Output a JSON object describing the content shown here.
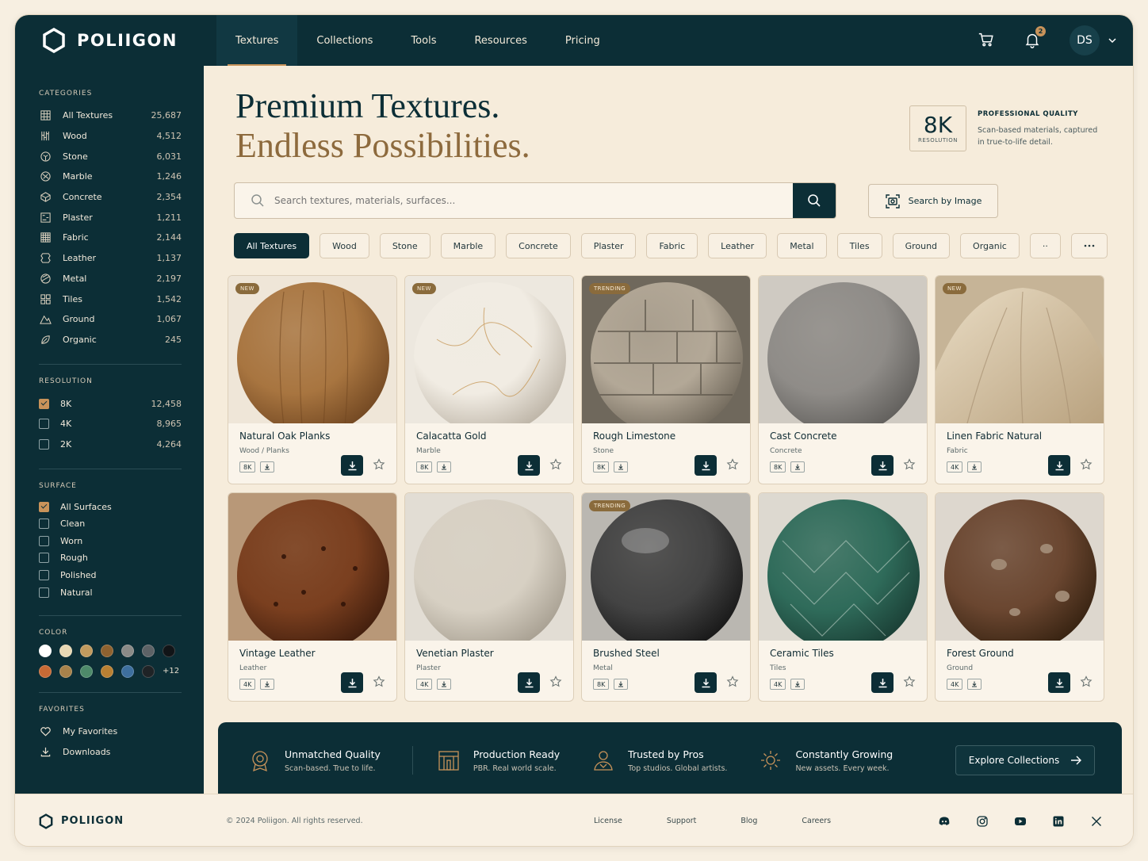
{
  "brand": {
    "name": "POLIIGON"
  },
  "nav": {
    "links": [
      "Textures",
      "Collections",
      "Tools",
      "Resources",
      "Pricing"
    ],
    "active": "Textures",
    "notifications_count": "2",
    "avatar_initials": "DS"
  },
  "sidebar": {
    "categories_title": "CATEGORIES",
    "categories": [
      {
        "label": "All Textures",
        "count": "25,687",
        "icon": "grid-icon"
      },
      {
        "label": "Wood",
        "count": "4,512",
        "icon": "wood-icon"
      },
      {
        "label": "Stone",
        "count": "6,031",
        "icon": "stone-icon"
      },
      {
        "label": "Marble",
        "count": "1,246",
        "icon": "marble-icon"
      },
      {
        "label": "Concrete",
        "count": "2,354",
        "icon": "cube-icon"
      },
      {
        "label": "Plaster",
        "count": "1,211",
        "icon": "plaster-icon"
      },
      {
        "label": "Fabric",
        "count": "2,144",
        "icon": "fabric-icon"
      },
      {
        "label": "Leather",
        "count": "1,137",
        "icon": "leather-icon"
      },
      {
        "label": "Metal",
        "count": "2,197",
        "icon": "metal-icon"
      },
      {
        "label": "Tiles",
        "count": "1,542",
        "icon": "tiles-icon"
      },
      {
        "label": "Ground",
        "count": "1,067",
        "icon": "mountain-icon"
      },
      {
        "label": "Organic",
        "count": "245",
        "icon": "leaf-icon"
      }
    ],
    "resolution_title": "RESOLUTION",
    "resolutions": [
      {
        "label": "8K",
        "count": "12,458",
        "checked": true
      },
      {
        "label": "4K",
        "count": "8,965",
        "checked": false
      },
      {
        "label": "2K",
        "count": "4,264",
        "checked": false
      }
    ],
    "surface_title": "SURFACE",
    "surfaces": [
      {
        "label": "All Surfaces",
        "checked": true
      },
      {
        "label": "Clean",
        "checked": false
      },
      {
        "label": "Worn",
        "checked": false
      },
      {
        "label": "Rough",
        "checked": false
      },
      {
        "label": "Polished",
        "checked": false
      },
      {
        "label": "Natural",
        "checked": false
      }
    ],
    "color_title": "COLOR",
    "colors": [
      "#ffffff",
      "#e8d8b4",
      "#c19a5e",
      "#8e6230",
      "#8a8a87",
      "#5d6266",
      "#111417",
      "#c86a35",
      "#a8824b",
      "#4e8a6a",
      "#b98033",
      "#3e6f9e",
      "#1f2326"
    ],
    "colors_more": "+12",
    "favorites_title": "FAVORITES",
    "favorites": [
      "My Favorites",
      "Downloads"
    ]
  },
  "hero": {
    "line1": "Premium Textures.",
    "line2": "Endless Possibilities.",
    "res_value": "8K",
    "res_label": "RESOLUTION",
    "quality_title": "PROFESSIONAL QUALITY",
    "quality_desc": "Scan-based materials, captured in true-to-life detail."
  },
  "search": {
    "placeholder": "Search textures, materials, surfaces...",
    "image_search_label": "Search by Image"
  },
  "filters": [
    "All Textures",
    "Wood",
    "Stone",
    "Marble",
    "Concrete",
    "Plaster",
    "Fabric",
    "Leather",
    "Metal",
    "Tiles",
    "Ground",
    "Organic",
    "··"
  ],
  "cards": [
    {
      "name": "Natural Oak Planks",
      "category": "Wood / Planks",
      "res": "8K",
      "tag": "NEW"
    },
    {
      "name": "Calacatta Gold",
      "category": "Marble",
      "res": "8K",
      "tag": "NEW"
    },
    {
      "name": "Rough Limestone",
      "category": "Stone",
      "res": "8K",
      "tag": "TRENDING"
    },
    {
      "name": "Cast Concrete",
      "category": "Concrete",
      "res": "8K",
      "tag": ""
    },
    {
      "name": "Linen Fabric Natural",
      "category": "Fabric",
      "res": "4K",
      "tag": "NEW"
    },
    {
      "name": "Vintage Leather",
      "category": "Leather",
      "res": "4K",
      "tag": ""
    },
    {
      "name": "Venetian Plaster",
      "category": "Plaster",
      "res": "4K",
      "tag": ""
    },
    {
      "name": "Brushed Steel",
      "category": "Metal",
      "res": "8K",
      "tag": "TRENDING"
    },
    {
      "name": "Ceramic Tiles",
      "category": "Tiles",
      "res": "4K",
      "tag": ""
    },
    {
      "name": "Forest Ground",
      "category": "Ground",
      "res": "4K",
      "tag": ""
    }
  ],
  "banner": {
    "features": [
      {
        "title": "Unmatched Quality",
        "sub": "Scan-based. True to life."
      },
      {
        "title": "Production Ready",
        "sub": "PBR. Real world scale."
      },
      {
        "title": "Trusted by Pros",
        "sub": "Top studios. Global artists."
      },
      {
        "title": "Constantly Growing",
        "sub": "New assets. Every week."
      }
    ],
    "cta": "Explore Collections"
  },
  "footer": {
    "copyright": "© 2024 Poliigon. All rights reserved.",
    "links": [
      "License",
      "Support",
      "Blog",
      "Careers"
    ]
  }
}
